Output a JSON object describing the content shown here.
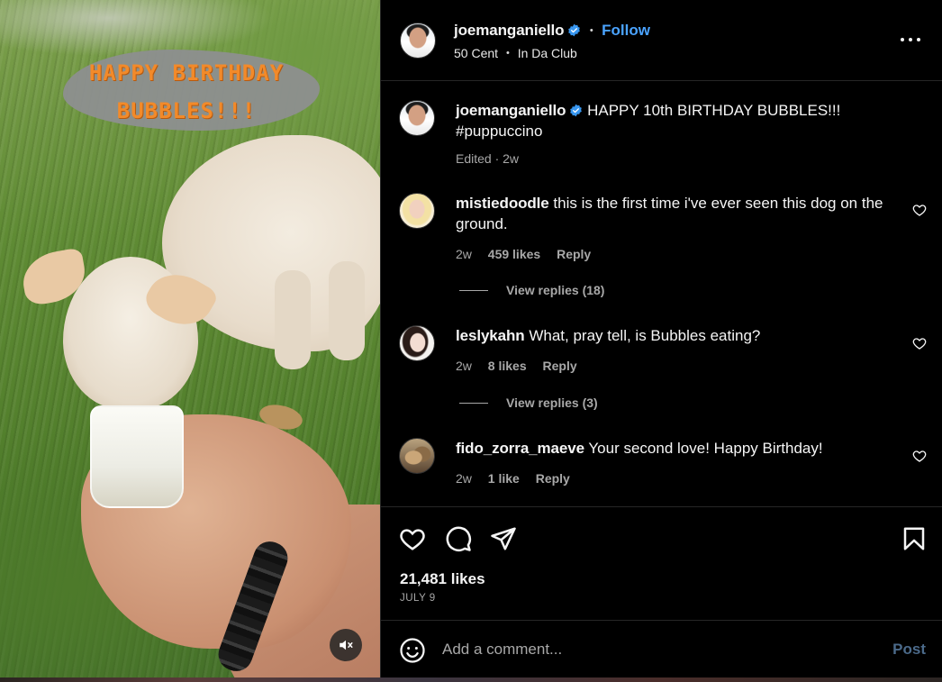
{
  "media": {
    "overlay_text_line1": "HAPPY BIRTHDAY",
    "overlay_text_line2": "BUBBLES!!!",
    "mute_icon": "speaker-muted-icon"
  },
  "header": {
    "username": "joemanganiello",
    "verified_icon": "verified-badge-icon",
    "separator": "•",
    "follow_label": "Follow",
    "audio_artist": "50 Cent",
    "audio_track": "In Da Club",
    "more_icon": "more-options-icon"
  },
  "caption": {
    "username": "joemanganiello",
    "text": "HAPPY 10th BIRTHDAY BUBBLES!!! #puppuccino",
    "meta": "Edited · 2w"
  },
  "comments": [
    {
      "username": "mistiedoodle",
      "text": "this is the first time i've ever seen this dog on the ground.",
      "age": "2w",
      "likes": "459 likes",
      "reply_label": "Reply",
      "view_replies": "View replies (18)"
    },
    {
      "username": "leslykahn",
      "text": "What, pray tell, is Bubbles eating?",
      "age": "2w",
      "likes": "8 likes",
      "reply_label": "Reply",
      "view_replies": "View replies (3)"
    },
    {
      "username": "fido_zorra_maeve",
      "text": "Your second love! Happy Birthday!",
      "age": "2w",
      "likes": "1 like",
      "reply_label": "Reply"
    }
  ],
  "actions": {
    "like_icon": "heart-icon",
    "comment_icon": "comment-bubble-icon",
    "share_icon": "paper-plane-icon",
    "save_icon": "bookmark-icon",
    "likes_count": "21,481 likes",
    "date": "JULY 9"
  },
  "composer": {
    "emoji_icon": "emoji-smiley-icon",
    "placeholder": "Add a comment...",
    "post_label": "Post"
  },
  "colors": {
    "background": "#000000",
    "text": "#f5f5f5",
    "muted": "#a8a8a8",
    "link": "#4aa3ff",
    "post_disabled": "#4b6a8a",
    "verified": "#3897f0",
    "overlay_text": "#f28a2a"
  }
}
